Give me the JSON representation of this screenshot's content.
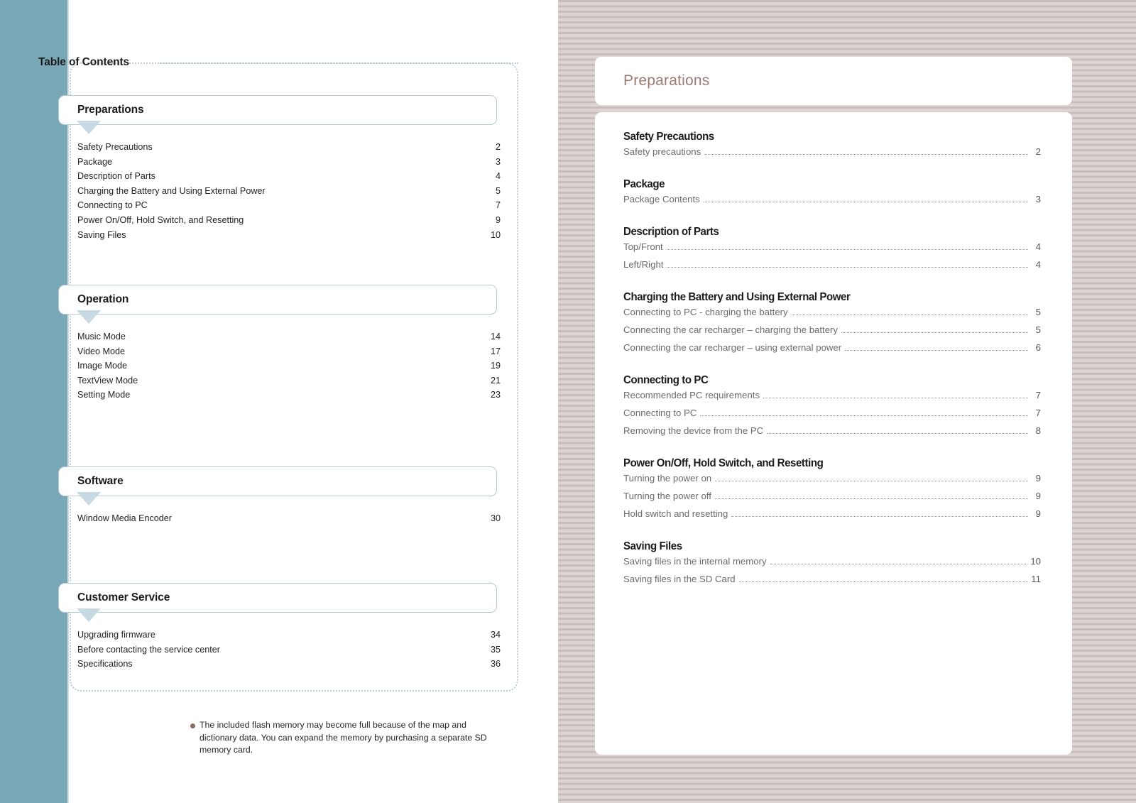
{
  "left_page": {
    "title": "Table of Contents",
    "sections": [
      {
        "name": "Preparations",
        "entries": [
          {
            "label": "Safety Precautions",
            "page": "2"
          },
          {
            "label": "Package",
            "page": "3"
          },
          {
            "label": "Description of Parts",
            "page": "4"
          },
          {
            "label": "Charging the Battery and Using External Power",
            "page": "5"
          },
          {
            "label": "Connecting to PC",
            "page": "7"
          },
          {
            "label": "Power On/Off, Hold Switch, and Resetting",
            "page": "9"
          },
          {
            "label": "Saving Files",
            "page": "10"
          }
        ]
      },
      {
        "name": "Operation",
        "entries": [
          {
            "label": "Music Mode",
            "page": "14"
          },
          {
            "label": "Video Mode",
            "page": "17"
          },
          {
            "label": "Image Mode",
            "page": "19"
          },
          {
            "label": "TextView Mode",
            "page": "21"
          },
          {
            "label": "Setting Mode",
            "page": "23"
          }
        ]
      },
      {
        "name": "Software",
        "entries": [
          {
            "label": "Window Media Encoder",
            "page": "30"
          }
        ]
      },
      {
        "name": "Customer Service",
        "entries": [
          {
            "label": "Upgrading firmware",
            "page": "34"
          },
          {
            "label": "Before contacting the service center",
            "page": "35"
          },
          {
            "label": "Specifications",
            "page": "36"
          }
        ]
      }
    ],
    "footnote": "The included flash memory may become full because of the map and dictionary data. You can expand the memory by purchasing a separate SD memory card."
  },
  "right_page": {
    "header_title": "Preparations",
    "groups": [
      {
        "heading": "Safety Precautions",
        "rows": [
          {
            "label": "Safety precautions",
            "page": "2"
          }
        ]
      },
      {
        "heading": "Package",
        "rows": [
          {
            "label": "Package Contents",
            "page": "3"
          }
        ]
      },
      {
        "heading": "Description of Parts",
        "rows": [
          {
            "label": "Top/Front",
            "page": "4"
          },
          {
            "label": "Left/Right",
            "page": "4"
          }
        ]
      },
      {
        "heading": "Charging the Battery and Using External Power",
        "rows": [
          {
            "label": "Connecting to PC - charging the battery",
            "page": "5"
          },
          {
            "label": "Connecting the car recharger – charging the battery",
            "page": "5"
          },
          {
            "label": "Connecting the car recharger – using external power",
            "page": "6"
          }
        ]
      },
      {
        "heading": "Connecting to PC",
        "rows": [
          {
            "label": "Recommended PC requirements",
            "page": "7"
          },
          {
            "label": "Connecting to PC",
            "page": "7"
          },
          {
            "label": "Removing the device from the PC",
            "page": "8"
          }
        ]
      },
      {
        "heading": "Power On/Off, Hold Switch, and Resetting",
        "rows": [
          {
            "label": "Turning the power on",
            "page": "9"
          },
          {
            "label": "Turning the power off",
            "page": "9"
          },
          {
            "label": "Hold switch and resetting",
            "page": "9"
          }
        ]
      },
      {
        "heading": "Saving Files",
        "rows": [
          {
            "label": "Saving files in the internal memory",
            "page": "10"
          },
          {
            "label": "Saving files in the SD Card",
            "page": "11"
          }
        ]
      }
    ]
  },
  "colors": {
    "spine_blue": "#79a7b6",
    "accent_border": "#b3cbd6",
    "arrow_fill": "#c7d9e2",
    "right_bg_dark": "#cabebb",
    "right_bg_light": "#ddd5d3",
    "right_heading_brown": "#9d7b74",
    "footnote_bullet": "#8b6b62"
  }
}
